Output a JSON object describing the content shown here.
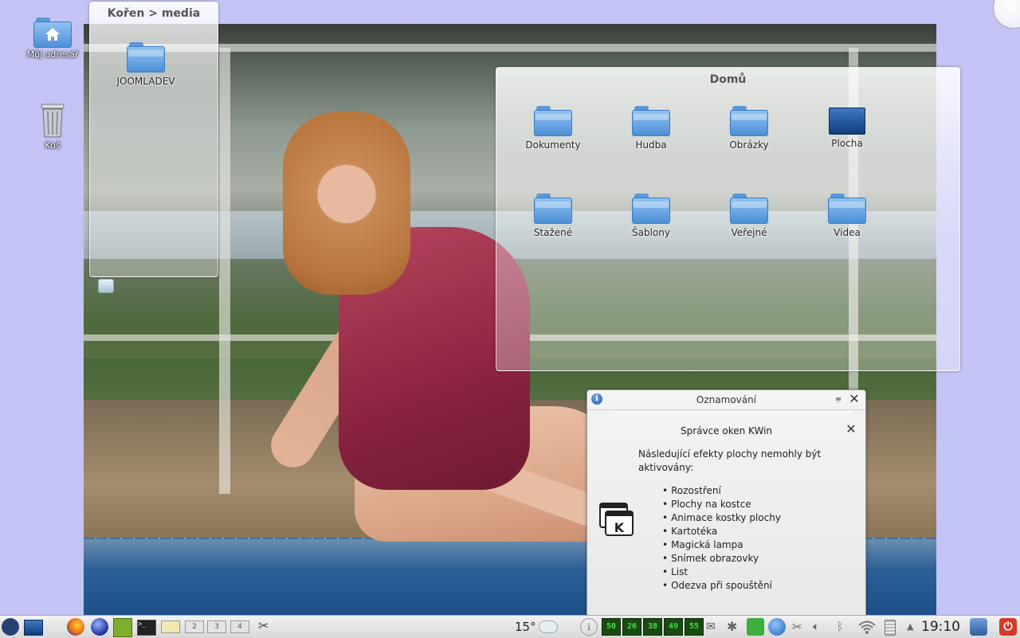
{
  "desktop_icons": [
    {
      "label": "Můj adresář",
      "icon": "home-folder-icon"
    },
    {
      "label": "Koš",
      "icon": "trash-icon"
    }
  ],
  "folderview_media": {
    "title": "Kořen > media",
    "items": [
      {
        "label": "JOOMLADEV",
        "icon": "folder-icon"
      }
    ]
  },
  "folderview_home": {
    "title": "Domů",
    "items": [
      {
        "label": "Dokumenty",
        "icon": "folder-icon"
      },
      {
        "label": "Hudba",
        "icon": "folder-icon"
      },
      {
        "label": "Obrázky",
        "icon": "folder-icon"
      },
      {
        "label": "Plocha",
        "icon": "desktop-icon"
      },
      {
        "label": "Stažené",
        "icon": "folder-icon"
      },
      {
        "label": "Šablony",
        "icon": "folder-icon"
      },
      {
        "label": "Veřejné",
        "icon": "folder-icon"
      },
      {
        "label": "Videa",
        "icon": "folder-icon"
      }
    ]
  },
  "notification": {
    "title": "Oznamování",
    "subtitle": "Správce oken KWin",
    "message": "Následující efekty plochy nemohly být aktivovány:",
    "effects": [
      "Rozostření",
      "Plochy na kostce",
      "Animace kostky plochy",
      "Kartotéka",
      "Magická lampa",
      "Snímek obrazovky",
      "List",
      "Odezva při spouštění"
    ]
  },
  "taskbar": {
    "pager": [
      "2",
      "3",
      "4"
    ],
    "temperature": "15°",
    "cpu_meters": [
      "50",
      "26",
      "38",
      "49",
      "55"
    ],
    "clock": "19:10"
  },
  "colors": {
    "desktop_bg": "#c3c3f5",
    "fedora_blue": "#294172",
    "cpu_green": "#3de040"
  }
}
